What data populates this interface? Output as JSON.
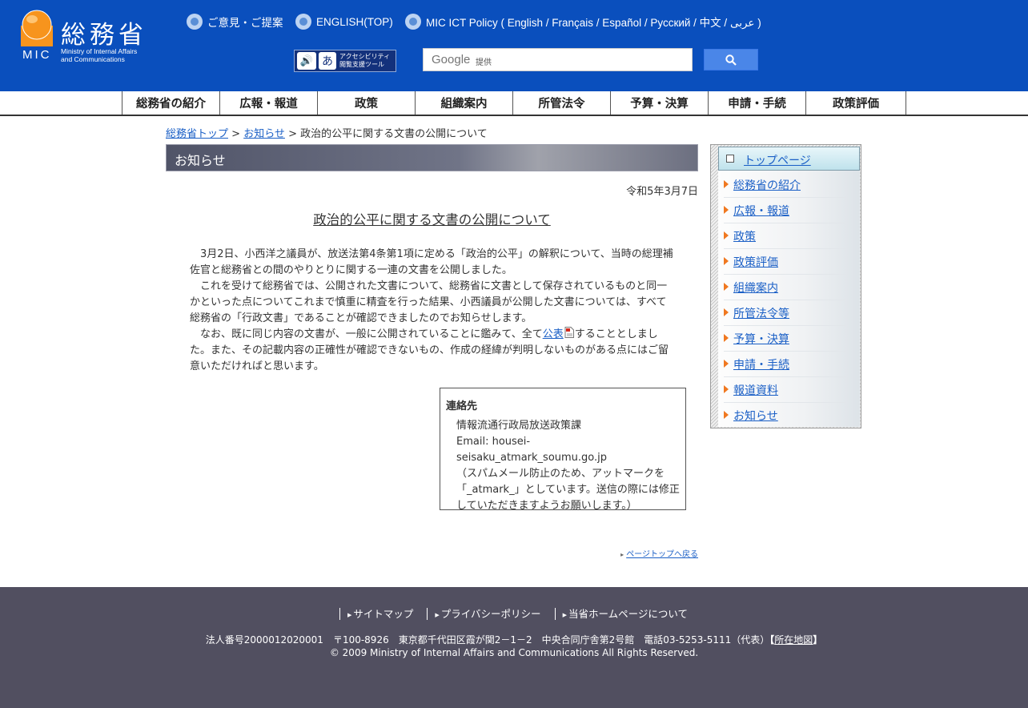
{
  "header": {
    "logo_kanji": "総務省",
    "logo_abbr": "MIC",
    "logo_en_line1": "Ministry of Internal Affairs",
    "logo_en_line2": "and Communications",
    "links": [
      {
        "label": "ご意見・ご提案"
      },
      {
        "label": "ENGLISH(TOP)"
      },
      {
        "label": "MIC ICT Policy ( English / Français / Español / Русский / 中文 / عربى )"
      }
    ],
    "accessibility_line1": "アクセシビリティ",
    "accessibility_line2": "閲覧支援ツール",
    "search_brand": "Google",
    "search_provided": "提供"
  },
  "nav": {
    "items": [
      "総務省の紹介",
      "広報・報道",
      "政策",
      "組織案内",
      "所管法令",
      "予算・決算",
      "申請・手続",
      "政策評価"
    ]
  },
  "breadcrumb": {
    "home": "総務省トップ",
    "sep1": " > ",
    "news": "お知らせ",
    "sep2": " > ",
    "current": "政治的公平に関する文書の公開について"
  },
  "main": {
    "section_title": "お知らせ",
    "date": "令和5年3月7日",
    "doc_title": "政治的公平に関する文書の公開について",
    "para1": "3月2日、小西洋之議員が、放送法第4条第1項に定める「政治的公平」の解釈について、当時の総理補佐官と総務省との間のやりとりに関する一連の文書を公開しました。",
    "para2": "これを受けて総務省では、公開された文書について、総務省に文書として保存されているものと同一かといった点についてこれまで慎重に精査を行った結果、小西議員が公開した文書については、すべて総務省の「行政文書」であることが確認できましたのでお知らせします。",
    "para3_before": "なお、既に同じ内容の文書が、一般に公開されていることに鑑みて、全て",
    "para3_link": "公表",
    "para3_after": "することとしました。また、その記載内容の正確性が確認できないもの、作成の経緯が判明しないものがある点にはご留意いただければと思います。",
    "contact_heading": "連絡先",
    "contact_dept": "情報流通行政局放送政策課",
    "contact_email": "Email: housei-seisaku_atmark_soumu.go.jp",
    "contact_note": "（スパムメール防止のため、アットマークを「_atmark_」としています。送信の際には修正していただきますようお願いします。）",
    "page_top": "ページトップへ戻る"
  },
  "side": {
    "top": "トップページ",
    "items": [
      "総務省の紹介",
      "広報・報道",
      "政策",
      "政策評価",
      "組織案内",
      "所管法令等",
      "予算・決算",
      "申請・手続",
      "報道資料",
      "お知らせ"
    ]
  },
  "footer": {
    "links": [
      "サイトマップ",
      "プライバシーポリシー",
      "当省ホームページについて"
    ],
    "address": "法人番号2000012020001　〒100-8926　東京都千代田区霞が関2－1－2　中央合同庁舎第2号館　電話03-5253-5111（代表）",
    "map_link": "所在地図",
    "bracket_open": "【",
    "bracket_close": "】",
    "copyright": "© 2009 Ministry of Internal Affairs and Communications All Rights Reserved."
  },
  "colors": {
    "header_bg": "#0a4fbd",
    "footer_bg": "#514f60",
    "link": "#1a5fc6",
    "side_arrow": "#f07820"
  }
}
